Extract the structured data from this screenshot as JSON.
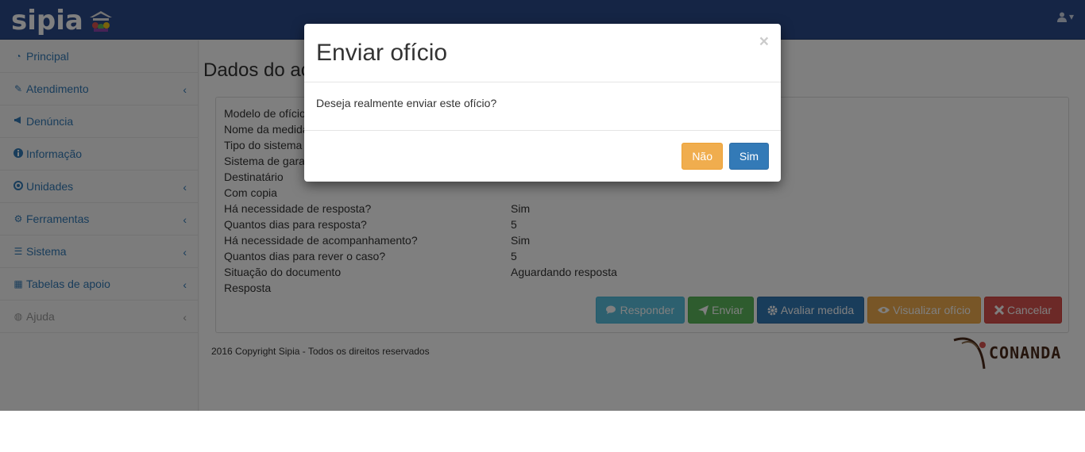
{
  "navbar": {
    "brand": "sipia",
    "user_caret": "▾"
  },
  "sidebar": {
    "items": [
      {
        "label": "Principal",
        "icon": "dashboard-icon",
        "glyph": "◔",
        "chevron": ""
      },
      {
        "label": "Atendimento",
        "icon": "edit-icon",
        "glyph": "✎",
        "chevron": "‹"
      },
      {
        "label": "Denúncia",
        "icon": "bullhorn-icon",
        "glyph": "📢",
        "chevron": ""
      },
      {
        "label": "Informação",
        "icon": "info-icon",
        "glyph": "ℹ",
        "chevron": ""
      },
      {
        "label": "Unidades",
        "icon": "target-icon",
        "glyph": "◉",
        "chevron": "‹"
      },
      {
        "label": "Ferramentas",
        "icon": "cogs-icon",
        "glyph": "⚙",
        "chevron": "‹"
      },
      {
        "label": "Sistema",
        "icon": "sliders-icon",
        "glyph": "☰",
        "chevron": "‹"
      },
      {
        "label": "Tabelas de apoio",
        "icon": "table-icon",
        "glyph": "▦",
        "chevron": "‹"
      },
      {
        "label": "Ajuda",
        "icon": "lifebuoy-icon",
        "glyph": "◍",
        "chevron": "‹"
      }
    ]
  },
  "main": {
    "page_title": "Dados do ac",
    "fields": [
      {
        "label": "Modelo de ofício",
        "value": ""
      },
      {
        "label": "Nome da medida",
        "value": ""
      },
      {
        "label": "Tipo do sistema",
        "value": ""
      },
      {
        "label": "Sistema de gara",
        "value": ""
      },
      {
        "label": "Destinatário",
        "value": ""
      },
      {
        "label": "Com copia",
        "value": ""
      },
      {
        "label": "Há necessidade de resposta?",
        "value": "Sim"
      },
      {
        "label": "Quantos dias para resposta?",
        "value": "5"
      },
      {
        "label": "Há necessidade de acompanhamento?",
        "value": "Sim"
      },
      {
        "label": "Quantos dias para rever o caso?",
        "value": "5"
      },
      {
        "label": "Situação do documento",
        "value": "Aguardando resposta"
      },
      {
        "label": "Resposta",
        "value": ""
      }
    ],
    "buttons": {
      "responder": "Responder",
      "enviar": "Enviar",
      "avaliar": "Avaliar medida",
      "visualizar": "Visualizar ofício",
      "cancelar": "Cancelar"
    },
    "footer": "2016 Copyright Sipia - Todos os direitos reservados",
    "partner_logo": "CONANDA"
  },
  "modal": {
    "title": "Enviar ofício",
    "close": "×",
    "message": "Deseja realmente enviar este ofício?",
    "no_label": "Não",
    "yes_label": "Sim"
  },
  "colors": {
    "navbar": "#2a4a8a",
    "link": "#337ab7",
    "info": "#5bc0de",
    "success": "#5cb85c",
    "primary": "#337ab7",
    "warning": "#f0ad4e",
    "danger": "#d9534f"
  }
}
